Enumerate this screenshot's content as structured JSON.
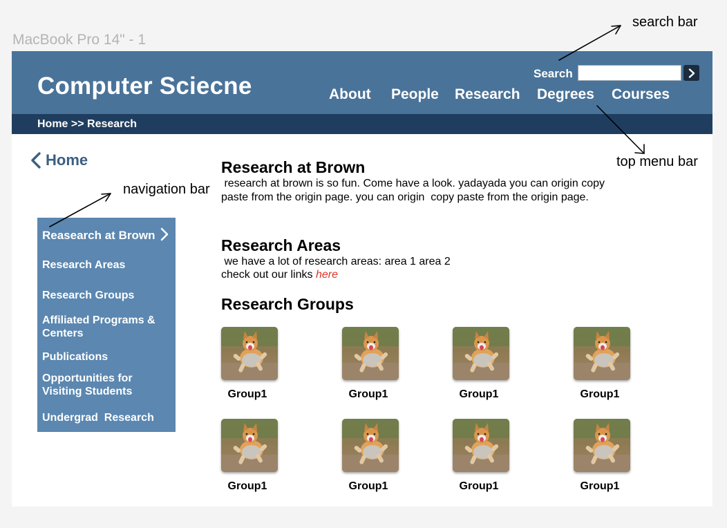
{
  "frame_label": "MacBook Pro 14\" - 1",
  "header": {
    "site_title": "Computer Sciecne",
    "search_label": "Search",
    "search_value": "",
    "search_go_icon": "chevron-right-icon",
    "menu": [
      "About",
      "People",
      "Research",
      "Degrees",
      "Courses"
    ]
  },
  "breadcrumb": "Home >> Research",
  "back_link": {
    "label": "Home",
    "icon": "chevron-left-icon"
  },
  "sidenav": {
    "items": [
      "Reasearch at Brown",
      "Research Areas",
      "Research Groups",
      "Affiliated Programs & Centers",
      "Publications",
      "Opportunities for Visiting Students",
      "Undergrad  Research"
    ],
    "active_icon": "chevron-right-icon"
  },
  "content": {
    "section1_title": "Research at Brown",
    "section1_text": " research at brown is so fun. Come have a look. yadayada you can origin copy paste from the origin page. you can origin  copy paste from the origin page.",
    "section2_title": "Research Areas",
    "section2_line1": " we have a lot of research areas: area 1 area 2",
    "section2_line2": "check out our links ",
    "section2_link": "here",
    "section3_title": "Research Groups",
    "groups": [
      "Group1",
      "Group1",
      "Group1",
      "Group1",
      "Group1",
      "Group1",
      "Group1",
      "Group1"
    ]
  },
  "annotations": {
    "search_bar": "search bar",
    "top_menu_bar": "top menu bar",
    "navigation_bar": "navigation bar"
  },
  "colors": {
    "header_bg": "#4a7399",
    "breadcrumb_bg": "#1f3d5e",
    "sidenav_bg": "#5b87b0",
    "link": "#d9352b"
  }
}
